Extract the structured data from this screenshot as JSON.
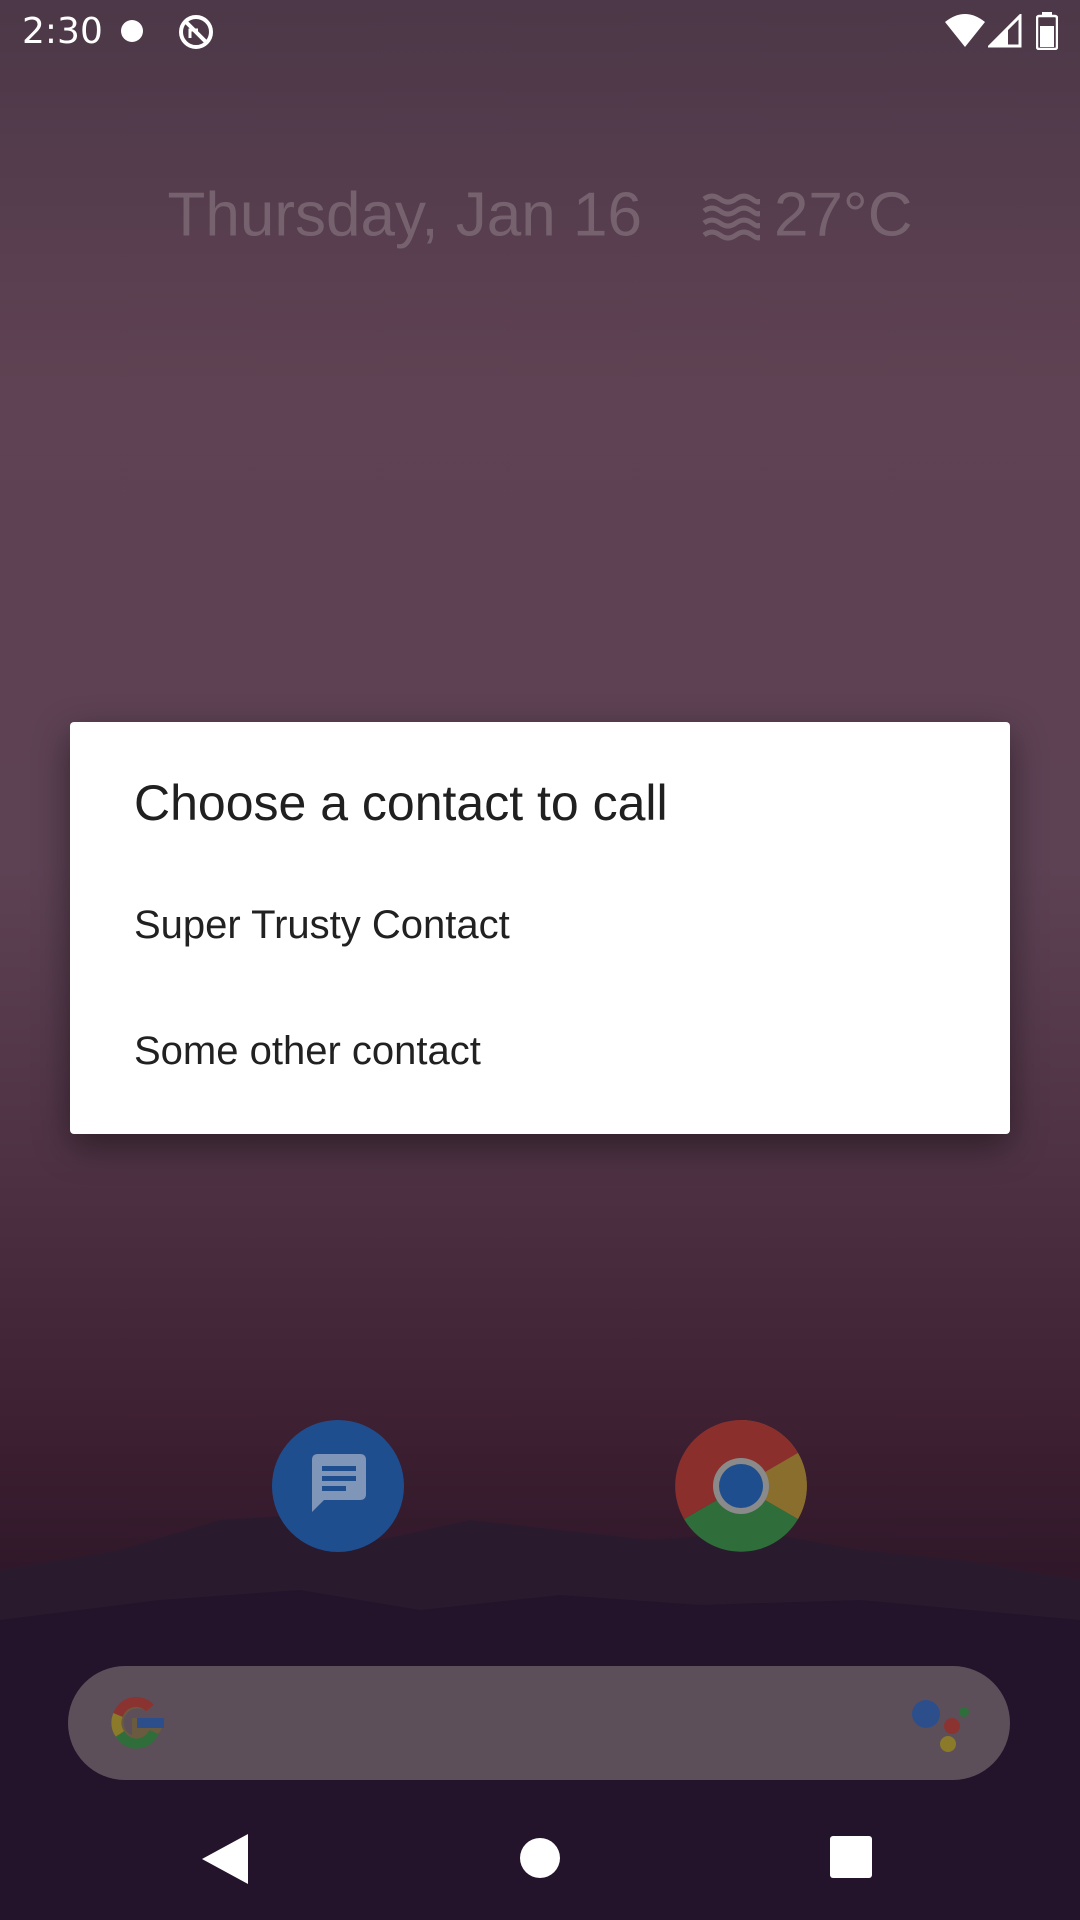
{
  "status_bar": {
    "time": "2:30",
    "icons": [
      "notification-dot-icon",
      "sync-icon",
      "wifi-icon",
      "signal-icon",
      "battery-icon"
    ]
  },
  "home_widget": {
    "date": "Thursday, Jan 16",
    "weather_icon": "haze-icon",
    "temperature": "27°C"
  },
  "dialog": {
    "title": "Choose a contact to call",
    "options": [
      {
        "label": "Super Trusty Contact"
      },
      {
        "label": "Some other contact"
      }
    ]
  },
  "home_apps": [
    {
      "icon": "messages-app-icon"
    },
    {
      "icon": "chrome-app-icon"
    }
  ],
  "search_bar": {
    "left_icon": "google-g-icon",
    "right_icon": "google-assistant-icon"
  },
  "navigation": {
    "icons": [
      "back-icon",
      "home-icon",
      "recents-icon"
    ]
  },
  "colors": {
    "dialog_bg": "#ffffff",
    "title_text": "#202020",
    "option_text": "#212121",
    "messages_blue": "#1f4e8f"
  }
}
